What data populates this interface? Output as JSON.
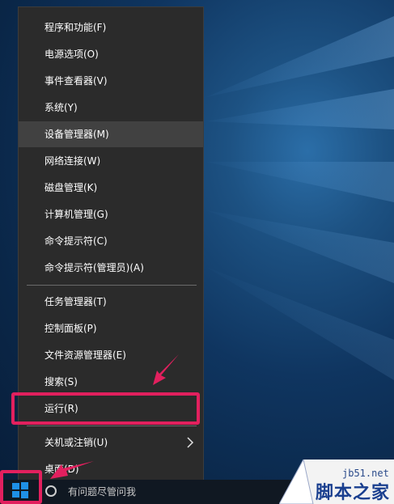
{
  "menu": {
    "items": [
      {
        "label": "程序和功能(F)"
      },
      {
        "label": "电源选项(O)"
      },
      {
        "label": "事件查看器(V)"
      },
      {
        "label": "系统(Y)"
      },
      {
        "label": "设备管理器(M)"
      },
      {
        "label": "网络连接(W)"
      },
      {
        "label": "磁盘管理(K)"
      },
      {
        "label": "计算机管理(G)"
      },
      {
        "label": "命令提示符(C)"
      },
      {
        "label": "命令提示符(管理员)(A)"
      },
      {
        "label": "任务管理器(T)"
      },
      {
        "label": "控制面板(P)"
      },
      {
        "label": "文件资源管理器(E)"
      },
      {
        "label": "搜索(S)"
      },
      {
        "label": "运行(R)"
      },
      {
        "label": "关机或注销(U)"
      },
      {
        "label": "桌面(D)"
      }
    ],
    "hovered_item": "设备管理器(M)",
    "submenu_icon": "chevron-right-icon"
  },
  "taskbar": {
    "start_icon": "windows-logo-icon",
    "search_placeholder": "有问题尽管问我",
    "search_icon": "cortana-circle-icon"
  },
  "annotations": {
    "highlight_color": "#e2205e",
    "arrow_color": "#e2205e"
  },
  "watermark": {
    "url": "jb51.net",
    "name": "脚本之家"
  }
}
